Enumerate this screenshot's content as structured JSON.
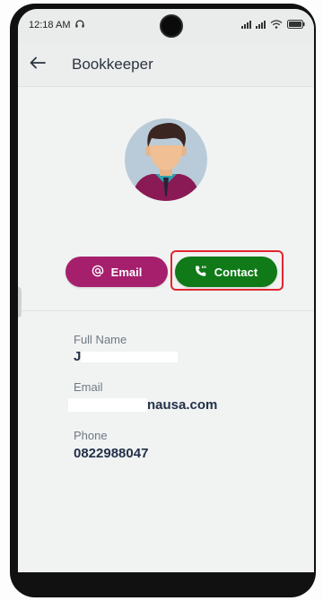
{
  "status_bar": {
    "time": "12:18 AM",
    "time_icon": "headphones-icon",
    "icons": [
      "signal-icon",
      "signal-icon",
      "wifi-icon",
      "battery-icon"
    ]
  },
  "app_bar": {
    "back_icon": "arrow-left-icon",
    "title": "Bookkeeper"
  },
  "profile": {
    "avatar": "male-avatar-illustration"
  },
  "actions": {
    "email_label": "Email",
    "email_icon": "at-sign-icon",
    "email_color": "#a51f6d",
    "contact_label": "Contact",
    "contact_icon": "phone-call-icon",
    "contact_color": "#0f7a17",
    "highlight_color": "#e3262e"
  },
  "details": {
    "full_name_label": "Full Name",
    "full_name_value": "J",
    "email_label": "Email",
    "email_value": "nausa.com",
    "phone_label": "Phone",
    "phone_value": "0822988047"
  }
}
